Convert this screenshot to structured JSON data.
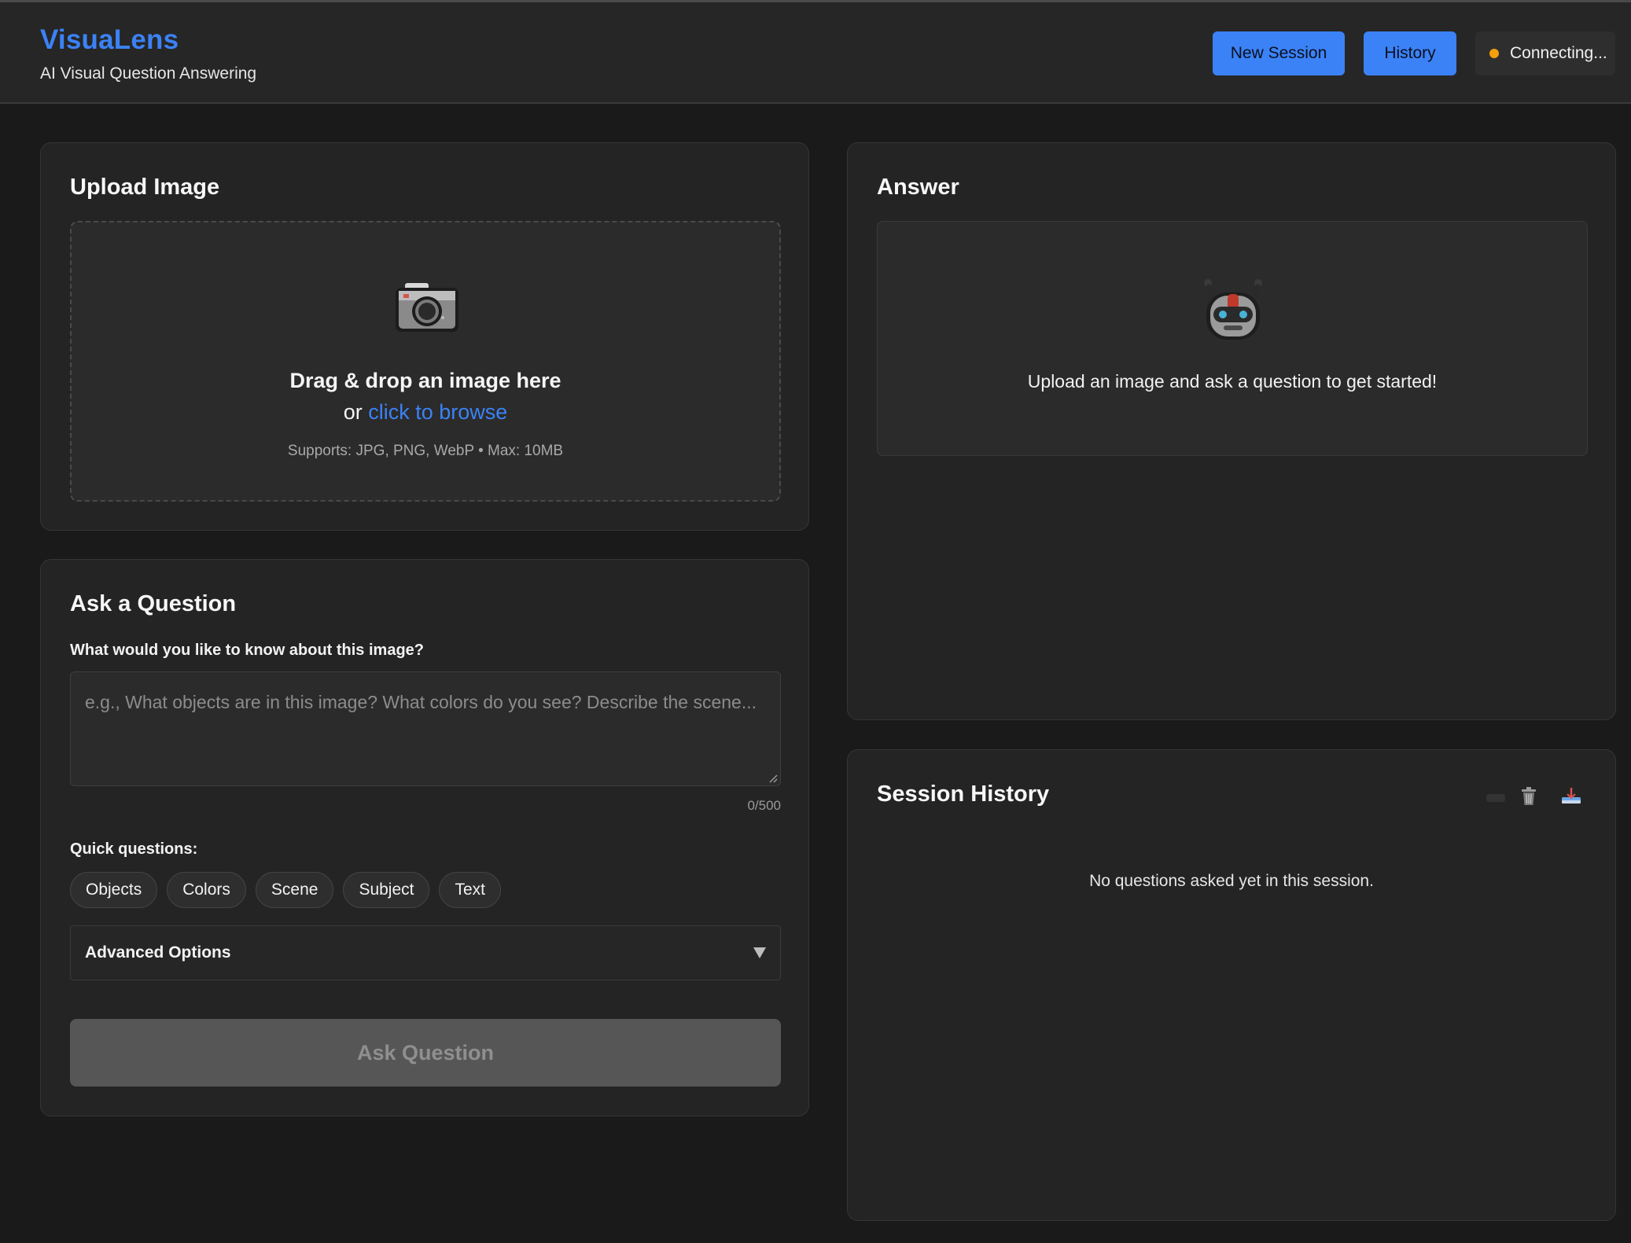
{
  "app": {
    "title": "VisuaLens",
    "subtitle": "AI Visual Question Answering"
  },
  "header": {
    "new_session_label": "New Session",
    "history_label": "History",
    "status_text": "Connecting...",
    "status_color": "#f59e0b"
  },
  "upload": {
    "title": "Upload Image",
    "icon": "camera-icon",
    "drop_text": "Drag & drop an image here",
    "or_text": "or",
    "browse_text": "click to browse",
    "support_text": "Supports: JPG, PNG, WebP • Max: 10MB"
  },
  "ask": {
    "title": "Ask a Question",
    "field_label": "What would you like to know about this image?",
    "placeholder": "e.g., What objects are in this image? What colors do you see? Describe the scene...",
    "char_count": "0/500",
    "quick_label": "Quick questions:",
    "quick_questions": [
      "Objects",
      "Colors",
      "Scene",
      "Subject",
      "Text"
    ],
    "advanced_label": "Advanced Options",
    "submit_label": "Ask Question"
  },
  "answer": {
    "title": "Answer",
    "icon": "robot-icon",
    "empty_text": "Upload an image and ask a question to get started!"
  },
  "history": {
    "title": "Session History",
    "empty_text": "No questions asked yet in this session."
  },
  "colors": {
    "accent": "#3b82f6",
    "background": "#1a1a1a",
    "card": "#242424"
  }
}
